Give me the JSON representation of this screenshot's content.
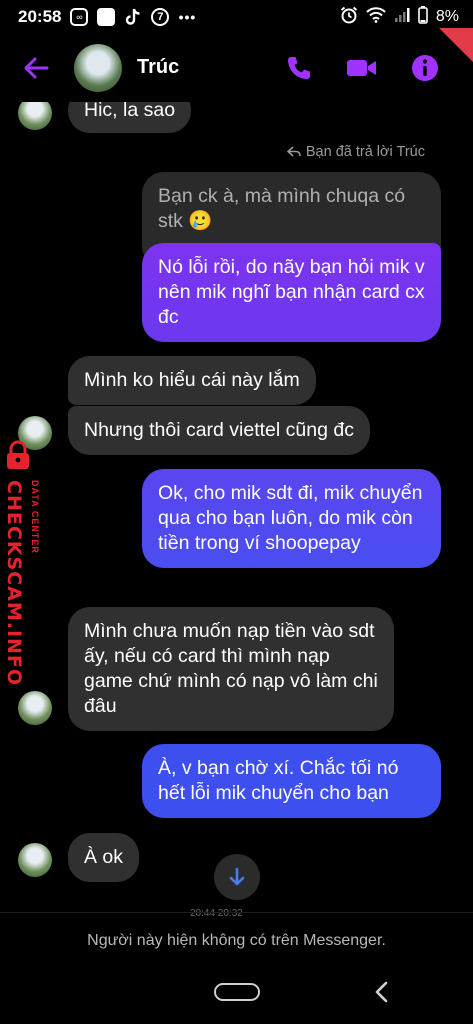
{
  "status_bar": {
    "time": "20:58",
    "app_icons": [
      "messenger-icon",
      "app-square-icon",
      "tiktok-icon",
      "seven-icon",
      "more-dots-icon"
    ],
    "seven_label": "7",
    "more": "•••",
    "battery": "8%"
  },
  "header": {
    "contact_name": "Trúc",
    "accent_color": "#a033ff"
  },
  "messages": {
    "m0": "Hic, la sao",
    "reply_note": "Bạn đã trả lời Trúc",
    "quoted": "Bạn ck à, mà mình chuqa có stk 🥲",
    "m1": "Nó lỗi rồi, do nãy bạn hỏi mik v nên mik nghĩ bạn nhận card cx đc",
    "m2": "Mình ko hiểu cái này lắm",
    "m3": "Nhưng thôi card viettel cũng đc",
    "m4": "Ok, cho mik sdt đi, mik chuyển qua cho bạn luôn, do mik còn tiền trong ví shoopepay",
    "m5": "Mình chưa muốn nạp tiền vào sdt ấy, nếu có card thì mình nạp game chứ mình có nạp vô làm chi đâu",
    "m6": "À, v bạn chờ xí. Chắc tối nó hết lỗi mik chuyển cho bạn",
    "m7": "À ok"
  },
  "watermark": {
    "main": "CHECKSCAM.INFO",
    "sub": "DATA CENTER",
    "color": "#e4232c"
  },
  "timestamp_partial": "20:44 20:32",
  "footer_text": "Người này hiện không có trên Messenger."
}
